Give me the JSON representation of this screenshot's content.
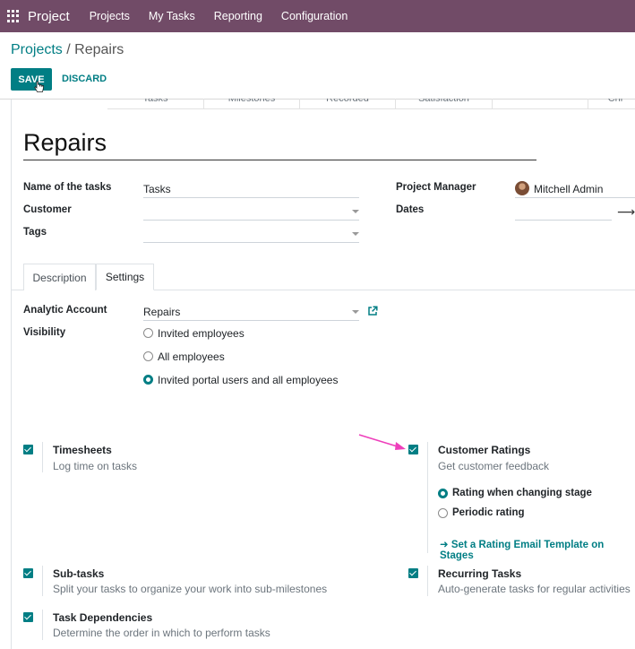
{
  "nav": {
    "brand": "Project",
    "items": [
      "Projects",
      "My Tasks",
      "Reporting",
      "Configuration"
    ]
  },
  "breadcrumb": {
    "parent": "Projects",
    "separator": " / ",
    "current": "Repairs"
  },
  "buttons": {
    "save": "SAVE",
    "discard": "DISCARD"
  },
  "stat_buttons": [
    "Tasks",
    "Milestones",
    "Recorded",
    "Satisfaction",
    "",
    "Chi"
  ],
  "form": {
    "title": "Repairs",
    "name_of_tasks_label": "Name of the tasks",
    "name_of_tasks_value": "Tasks",
    "customer_label": "Customer",
    "customer_value": "",
    "tags_label": "Tags",
    "tags_value": "",
    "project_manager_label": "Project Manager",
    "project_manager_value": "Mitchell Admin",
    "dates_label": "Dates",
    "dates_value": ""
  },
  "tabs": [
    "Description",
    "Settings"
  ],
  "settings": {
    "analytic_account_label": "Analytic Account",
    "analytic_account_value": "Repairs",
    "visibility_label": "Visibility",
    "visibility_options": [
      "Invited employees",
      "All employees",
      "Invited portal users and all employees"
    ],
    "visibility_selected": 2,
    "timesheets_title": "Timesheets",
    "timesheets_desc": "Log time on tasks",
    "customer_ratings_title": "Customer Ratings",
    "customer_ratings_desc": "Get customer feedback",
    "rating_options": [
      "Rating when changing stage",
      "Periodic rating"
    ],
    "rating_selected": 0,
    "rating_template_link": "Set a Rating Email Template on Stages",
    "subtasks_title": "Sub-tasks",
    "subtasks_desc": "Split your tasks to organize your work into sub-milestones",
    "recurring_title": "Recurring Tasks",
    "recurring_desc": "Auto-generate tasks for regular activities",
    "dependencies_title": "Task Dependencies",
    "dependencies_desc": "Determine the order in which to perform tasks"
  },
  "colors": {
    "nav": "#714B67",
    "accent": "#017e84",
    "annotation_arrow": "#ee3fbb"
  }
}
